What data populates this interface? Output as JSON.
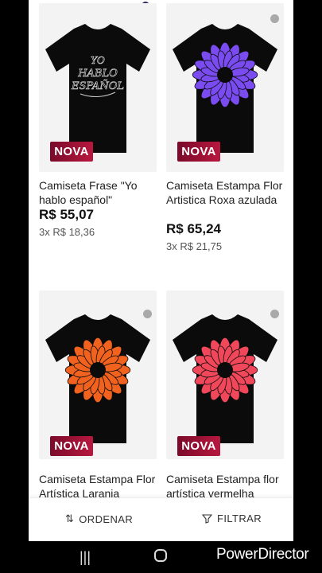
{
  "products": [
    {
      "title": "Camiseta Frase \"Yo hablo español\"",
      "badge": "NOVA",
      "price": "R$ 55,07",
      "installments": "3x R$ 18,36",
      "design": "text-print",
      "print_text": "YO HABLO ESPAÑOL"
    },
    {
      "title": "Camiseta Estampa Flor Artistica Roxa azulada",
      "badge": "NOVA",
      "price": "R$ 65,24",
      "installments": "3x R$ 21,75",
      "design": "flower",
      "print_color": "#7a4cf0"
    },
    {
      "title": "Camiseta Estampa Flor Artística Laranja",
      "badge": "NOVA",
      "design": "flower",
      "print_color": "#f0621e"
    },
    {
      "title": "Camiseta Estampa flor artística vermelha",
      "badge": "NOVA",
      "design": "flower",
      "print_color": "#f0485a"
    }
  ],
  "color_swatches": [
    "#2b2b5c",
    "#e0b03a",
    "#a9a9a9"
  ],
  "bottom_bar": {
    "sort_label": "ORDENAR",
    "filter_label": "FILTRAR"
  },
  "watermark": "PowerDirector",
  "colors": {
    "badge": "#a3143a",
    "shirt": "#0b0b0b"
  }
}
